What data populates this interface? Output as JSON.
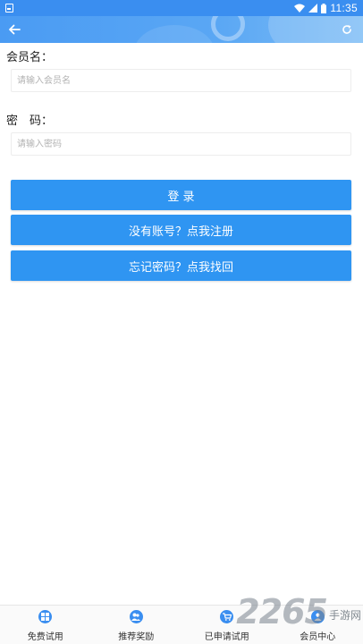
{
  "status_bar": {
    "time": "11:35",
    "notification_icon": "notification-icon",
    "wifi_icon": "wifi-icon",
    "signal_icon": "signal-icon",
    "battery_icon": "battery-icon"
  },
  "toolbar": {
    "back_icon": "arrow-left-icon",
    "refresh_icon": "refresh-icon"
  },
  "form": {
    "username_label": "会员名：",
    "username_placeholder": "请输入会员名",
    "password_label": "密　码：",
    "password_placeholder": "请输入密码"
  },
  "actions": {
    "login": "登 录",
    "register": "没有账号？点我注册",
    "forgot": "忘记密码？点我找回"
  },
  "bottom_nav": {
    "items": [
      {
        "label": "免费试用",
        "icon": "grid-icon"
      },
      {
        "label": "推荐奖励",
        "icon": "people-icon"
      },
      {
        "label": "已申请试用",
        "icon": "cart-icon"
      },
      {
        "label": "会员中心",
        "icon": "user-icon"
      }
    ]
  },
  "watermark": {
    "number": "2265",
    "text": "手游网"
  },
  "colors": {
    "primary": "#2f95f2",
    "header": "#4a9bf3"
  }
}
